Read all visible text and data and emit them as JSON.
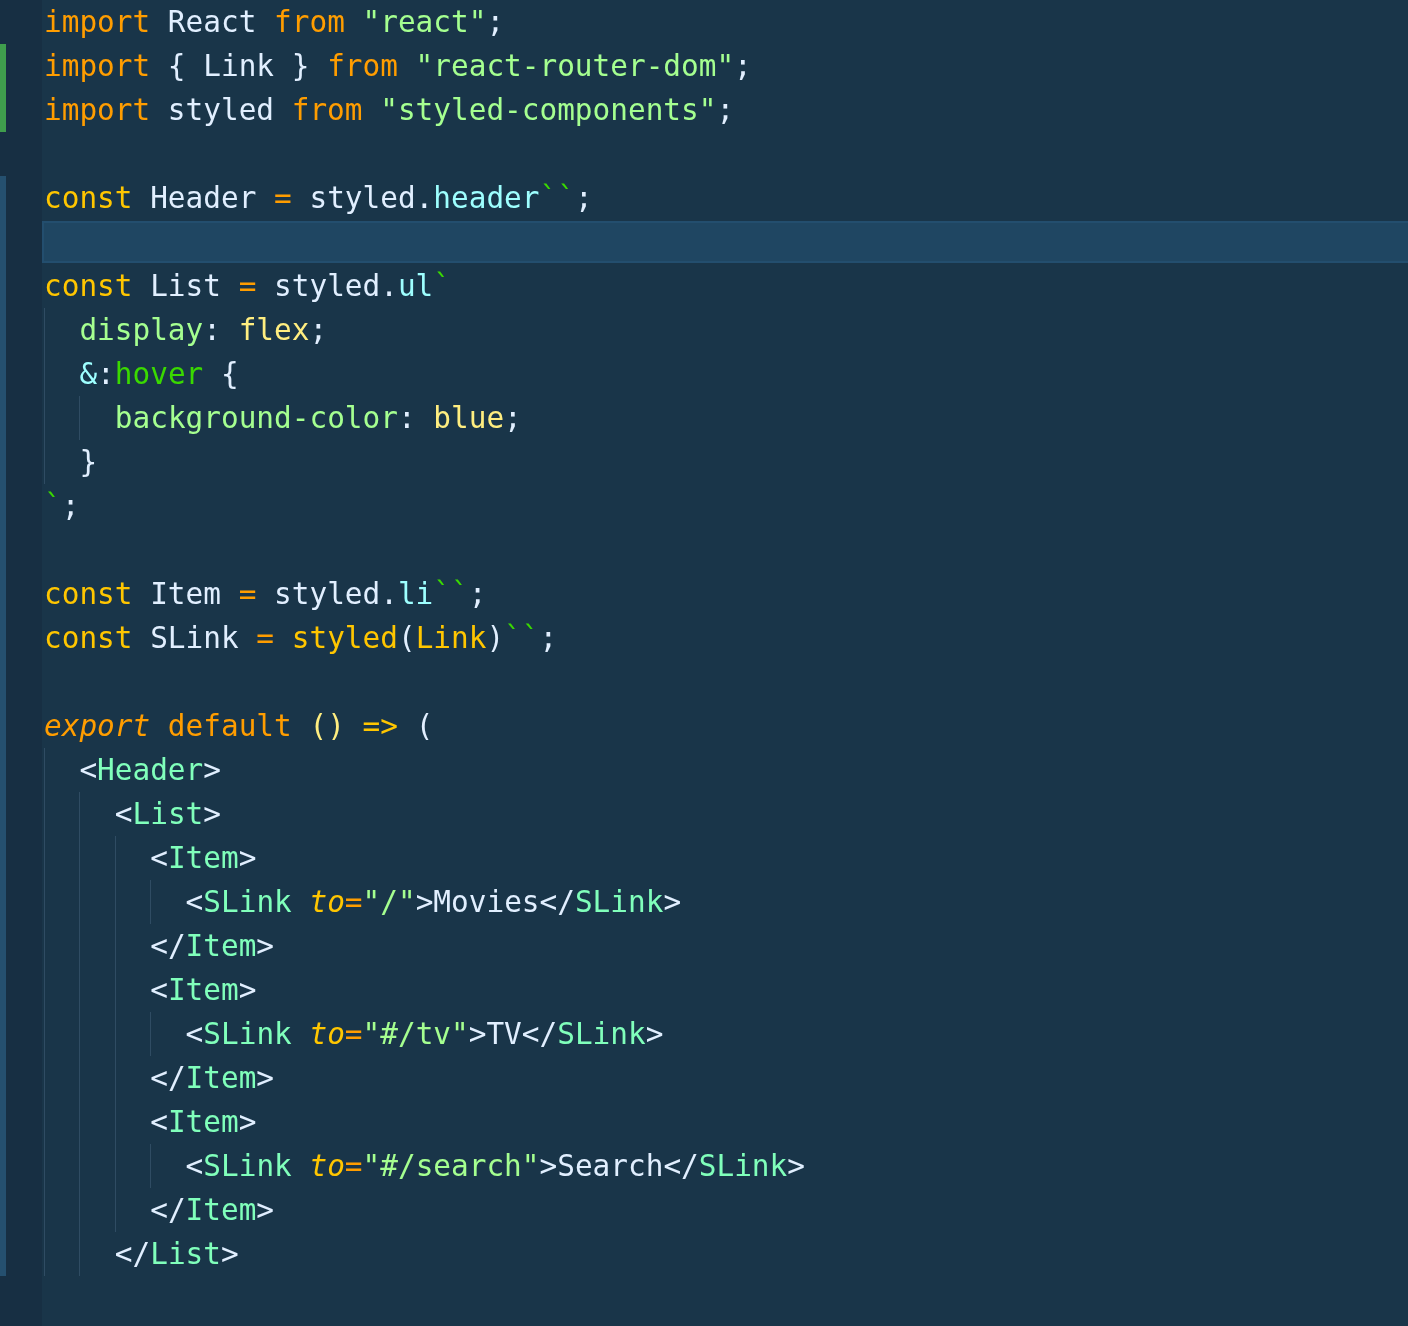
{
  "editor": {
    "lines": [
      {
        "added": false,
        "modified": false,
        "tokens": [
          {
            "text": "import",
            "kind": "keyword"
          },
          {
            "text": " React ",
            "kind": "plain"
          },
          {
            "text": "from",
            "kind": "keyword"
          },
          {
            "text": " \"react\"",
            "kind": "string"
          },
          {
            "text": ";",
            "kind": "plain"
          }
        ]
      },
      {
        "added": true,
        "modified": false,
        "tokens": [
          {
            "text": "import",
            "kind": "keyword"
          },
          {
            "text": " { Link } ",
            "kind": "plain"
          },
          {
            "text": "from",
            "kind": "keyword"
          },
          {
            "text": " \"react-router-dom\"",
            "kind": "string"
          },
          {
            "text": ";",
            "kind": "plain"
          }
        ]
      },
      {
        "added": true,
        "modified": false,
        "tokens": [
          {
            "text": "import",
            "kind": "keyword"
          },
          {
            "text": " styled ",
            "kind": "plain"
          },
          {
            "text": "from",
            "kind": "keyword"
          },
          {
            "text": " \"styled-components\"",
            "kind": "string"
          },
          {
            "text": ";",
            "kind": "plain"
          }
        ]
      },
      {
        "added": false,
        "modified": false
      },
      {
        "added": false,
        "modified": true,
        "tokens": [
          {
            "text": "const",
            "kind": "storage"
          },
          {
            "text": " Header ",
            "kind": "plain"
          },
          {
            "text": "=",
            "kind": "keyword"
          },
          {
            "text": " styled.",
            "kind": "plain"
          },
          {
            "text": "header",
            "kind": "property"
          },
          {
            "text": "``",
            "kind": "template"
          },
          {
            "text": ";",
            "kind": "plain"
          }
        ]
      },
      {
        "added": false,
        "modified": true,
        "current": true
      },
      {
        "added": false,
        "modified": true,
        "tokens": [
          {
            "text": "const",
            "kind": "storage"
          },
          {
            "text": " List ",
            "kind": "plain"
          },
          {
            "text": "=",
            "kind": "keyword"
          },
          {
            "text": " styled.",
            "kind": "plain"
          },
          {
            "text": "ul",
            "kind": "property"
          },
          {
            "text": "`",
            "kind": "template"
          }
        ]
      },
      {
        "added": false,
        "modified": true,
        "tokens": [
          {
            "text": "  display",
            "kind": "css-prop"
          },
          {
            "text": ": ",
            "kind": "plain"
          },
          {
            "text": "flex",
            "kind": "css-value"
          },
          {
            "text": ";",
            "kind": "plain"
          }
        ]
      },
      {
        "added": false,
        "modified": true,
        "tokens": [
          {
            "text": "  &",
            "kind": "property"
          },
          {
            "text": ":",
            "kind": "plain"
          },
          {
            "text": "hover",
            "kind": "selector"
          },
          {
            "text": " {",
            "kind": "plain"
          }
        ]
      },
      {
        "added": false,
        "modified": true,
        "tokens": [
          {
            "text": "    background-color",
            "kind": "css-prop"
          },
          {
            "text": ": ",
            "kind": "plain"
          },
          {
            "text": "blue",
            "kind": "css-value"
          },
          {
            "text": ";",
            "kind": "plain"
          }
        ]
      },
      {
        "added": false,
        "modified": true,
        "tokens": [
          {
            "text": "  }",
            "kind": "plain"
          }
        ]
      },
      {
        "added": false,
        "modified": true,
        "tokens": [
          {
            "text": "`",
            "kind": "template"
          },
          {
            "text": ";",
            "kind": "plain"
          }
        ]
      },
      {
        "added": false,
        "modified": true
      },
      {
        "added": false,
        "modified": true,
        "tokens": [
          {
            "text": "const",
            "kind": "storage"
          },
          {
            "text": " Item ",
            "kind": "plain"
          },
          {
            "text": "=",
            "kind": "keyword"
          },
          {
            "text": " styled.",
            "kind": "plain"
          },
          {
            "text": "li",
            "kind": "property"
          },
          {
            "text": "``",
            "kind": "template"
          },
          {
            "text": ";",
            "kind": "plain"
          }
        ]
      },
      {
        "added": false,
        "modified": true,
        "tokens": [
          {
            "text": "const",
            "kind": "storage"
          },
          {
            "text": " SLink ",
            "kind": "plain"
          },
          {
            "text": "= ",
            "kind": "keyword"
          },
          {
            "text": "styled",
            "kind": "storage"
          },
          {
            "text": "(",
            "kind": "plain"
          },
          {
            "text": "Link",
            "kind": "storage"
          },
          {
            "text": ")",
            "kind": "plain"
          },
          {
            "text": "``",
            "kind": "template"
          },
          {
            "text": ";",
            "kind": "plain"
          }
        ]
      },
      {
        "added": false,
        "modified": true
      },
      {
        "added": false,
        "modified": true,
        "tokens": [
          {
            "text": "export",
            "kind": "keyword-italic"
          },
          {
            "text": " default ",
            "kind": "keyword"
          },
          {
            "text": "() ",
            "kind": "css-value"
          },
          {
            "text": "=> ",
            "kind": "storage"
          },
          {
            "text": "(",
            "kind": "plain"
          }
        ]
      },
      {
        "added": false,
        "modified": true,
        "tokens": [
          {
            "text": "  <",
            "kind": "plain"
          },
          {
            "text": "Header",
            "kind": "tag"
          },
          {
            "text": ">",
            "kind": "plain"
          }
        ]
      },
      {
        "added": false,
        "modified": true,
        "tokens": [
          {
            "text": "    <",
            "kind": "plain"
          },
          {
            "text": "List",
            "kind": "tag"
          },
          {
            "text": ">",
            "kind": "plain"
          }
        ]
      },
      {
        "added": false,
        "modified": true,
        "tokens": [
          {
            "text": "      <",
            "kind": "plain"
          },
          {
            "text": "Item",
            "kind": "tag"
          },
          {
            "text": ">",
            "kind": "plain"
          }
        ]
      },
      {
        "added": false,
        "modified": true,
        "tokens": [
          {
            "text": "        <",
            "kind": "plain"
          },
          {
            "text": "SLink ",
            "kind": "tag"
          },
          {
            "text": "to",
            "kind": "attribute"
          },
          {
            "text": "=",
            "kind": "keyword"
          },
          {
            "text": "\"/\"",
            "kind": "string"
          },
          {
            "text": ">Movies</",
            "kind": "plain"
          },
          {
            "text": "SLink",
            "kind": "tag"
          },
          {
            "text": ">",
            "kind": "plain"
          }
        ]
      },
      {
        "added": false,
        "modified": true,
        "tokens": [
          {
            "text": "      </",
            "kind": "plain"
          },
          {
            "text": "Item",
            "kind": "tag"
          },
          {
            "text": ">",
            "kind": "plain"
          }
        ]
      },
      {
        "added": false,
        "modified": true,
        "tokens": [
          {
            "text": "      <",
            "kind": "plain"
          },
          {
            "text": "Item",
            "kind": "tag"
          },
          {
            "text": ">",
            "kind": "plain"
          }
        ]
      },
      {
        "added": false,
        "modified": true,
        "tokens": [
          {
            "text": "        <",
            "kind": "plain"
          },
          {
            "text": "SLink ",
            "kind": "tag"
          },
          {
            "text": "to",
            "kind": "attribute"
          },
          {
            "text": "=",
            "kind": "keyword"
          },
          {
            "text": "\"#/tv\"",
            "kind": "string"
          },
          {
            "text": ">TV</",
            "kind": "plain"
          },
          {
            "text": "SLink",
            "kind": "tag"
          },
          {
            "text": ">",
            "kind": "plain"
          }
        ]
      },
      {
        "added": false,
        "modified": true,
        "tokens": [
          {
            "text": "      </",
            "kind": "plain"
          },
          {
            "text": "Item",
            "kind": "tag"
          },
          {
            "text": ">",
            "kind": "plain"
          }
        ]
      },
      {
        "added": false,
        "modified": true,
        "tokens": [
          {
            "text": "      <",
            "kind": "plain"
          },
          {
            "text": "Item",
            "kind": "tag"
          },
          {
            "text": ">",
            "kind": "plain"
          }
        ]
      },
      {
        "added": false,
        "modified": true,
        "tokens": [
          {
            "text": "        <",
            "kind": "plain"
          },
          {
            "text": "SLink ",
            "kind": "tag"
          },
          {
            "text": "to",
            "kind": "attribute"
          },
          {
            "text": "=",
            "kind": "keyword"
          },
          {
            "text": "\"#/search\"",
            "kind": "string"
          },
          {
            "text": ">Search</",
            "kind": "plain"
          },
          {
            "text": "SLink",
            "kind": "tag"
          },
          {
            "text": ">",
            "kind": "plain"
          }
        ]
      },
      {
        "added": false,
        "modified": true,
        "tokens": [
          {
            "text": "      </",
            "kind": "plain"
          },
          {
            "text": "Item",
            "kind": "tag"
          },
          {
            "text": ">",
            "kind": "plain"
          }
        ]
      },
      {
        "added": false,
        "modified": true,
        "tokens": [
          {
            "text": "    </",
            "kind": "plain"
          },
          {
            "text": "List",
            "kind": "tag"
          },
          {
            "text": ">",
            "kind": "plain"
          }
        ]
      }
    ]
  }
}
